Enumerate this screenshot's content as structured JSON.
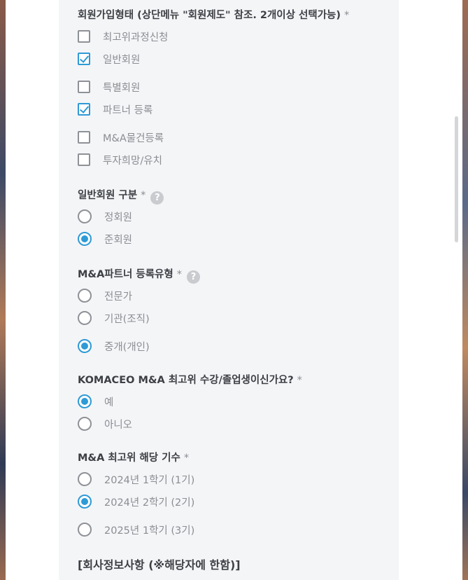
{
  "q1": {
    "label": "회원가입형태 (상단메뉴 \"회원제도\" 참조. 2개이상 선택가능)",
    "required": "*",
    "options": [
      {
        "label": "최고위과정신청",
        "checked": false
      },
      {
        "label": "일반회원",
        "checked": true
      },
      {
        "label": "특별회원",
        "checked": false
      },
      {
        "label": "파트너 등록",
        "checked": true
      },
      {
        "label": "M&A물건등록",
        "checked": false
      },
      {
        "label": "투자희망/유치",
        "checked": false
      }
    ]
  },
  "q2": {
    "label": "일반회원 구분",
    "required": "*",
    "help": "?",
    "options": [
      {
        "label": "정회원",
        "checked": false
      },
      {
        "label": "준회원",
        "checked": true
      }
    ]
  },
  "q3": {
    "label": "M&A파트너 등록유형",
    "required": "*",
    "help": "?",
    "options": [
      {
        "label": "전문가",
        "checked": false
      },
      {
        "label": "기관(조직)",
        "checked": false
      },
      {
        "label": "중개(개인)",
        "checked": true
      }
    ]
  },
  "q4": {
    "label": "KOMACEO M&A 최고위 수강/졸업생이신가요?",
    "required": "*",
    "options": [
      {
        "label": "예",
        "checked": true
      },
      {
        "label": "아니오",
        "checked": false
      }
    ]
  },
  "q5": {
    "label": "M&A 최고위 해당 기수",
    "required": "*",
    "options": [
      {
        "label": "2024년 1학기 (1기)",
        "checked": false
      },
      {
        "label": "2024년 2학기 (2기)",
        "checked": true
      },
      {
        "label": "2025년 1학기 (3기)",
        "checked": false
      }
    ]
  },
  "section": {
    "title": "[회사정보사항 (※해당자에 한함)]"
  },
  "colors": {
    "accent": "#2e9ad6",
    "panel": "#f4f5f7",
    "text": "#3c3f44",
    "muted": "#8a8d92"
  }
}
